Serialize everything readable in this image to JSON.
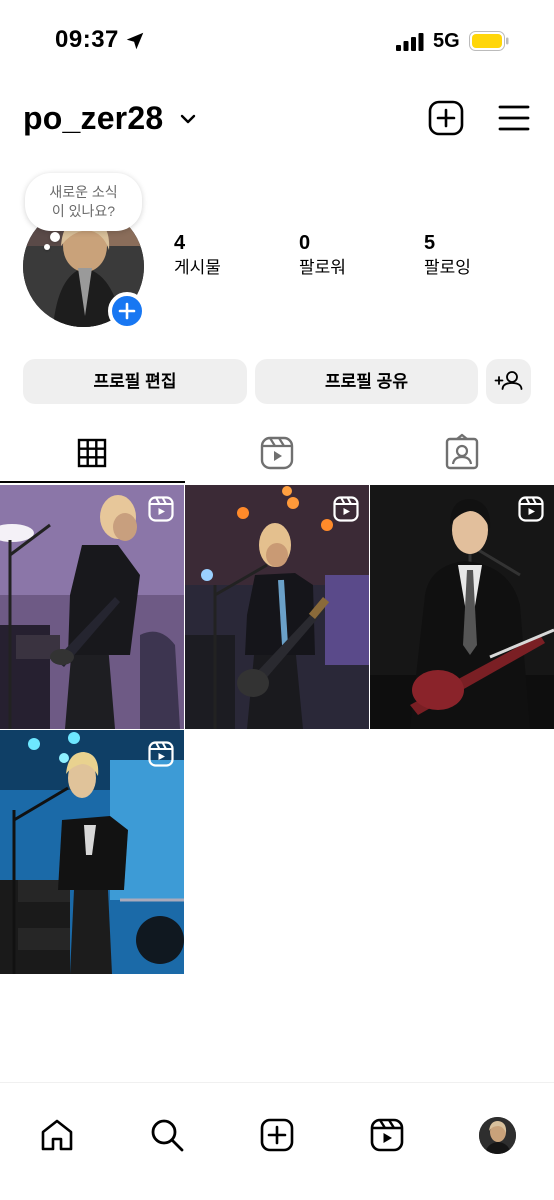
{
  "status_bar": {
    "time": "09:37",
    "network": "5G"
  },
  "header": {
    "username": "po_zer28"
  },
  "profile": {
    "note": "새로운 소식이 있나요?",
    "stats": [
      {
        "value": "4",
        "label": "게시물"
      },
      {
        "value": "0",
        "label": "팔로워"
      },
      {
        "value": "5",
        "label": "팔로잉"
      }
    ]
  },
  "buttons": {
    "edit_profile": "프로필 편집",
    "share_profile": "프로필 공유"
  },
  "tabs": [
    "grid-icon",
    "reels-icon",
    "tagged-icon"
  ],
  "posts": [
    {
      "type": "reel",
      "icon": "reel-icon"
    },
    {
      "type": "reel",
      "icon": "reel-icon"
    },
    {
      "type": "reel",
      "icon": "reel-icon"
    },
    {
      "type": "reel",
      "icon": "reel-icon"
    }
  ],
  "bottom_nav": [
    "home-icon",
    "search-icon",
    "create-icon",
    "reels-icon",
    "profile-avatar"
  ],
  "colors": {
    "accent": "#1877f2",
    "battery": "#ffd60a"
  }
}
